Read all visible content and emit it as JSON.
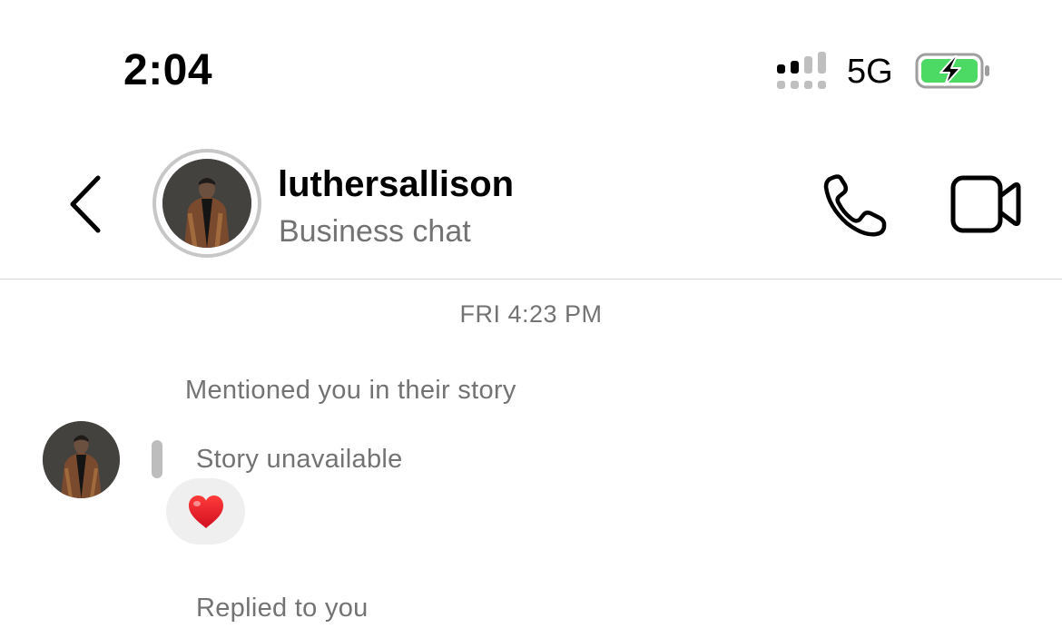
{
  "status_bar": {
    "time": "2:04",
    "network": "5G",
    "icons": [
      "signal-icon",
      "battery-charging-icon"
    ],
    "battery_color": "#4cd964"
  },
  "header": {
    "username": "luthersallison",
    "subtitle": "Business chat",
    "icons": [
      "back-chevron-icon",
      "phone-icon",
      "video-camera-icon"
    ]
  },
  "conversation": {
    "timestamp": "FRI 4:23 PM",
    "mention_label": "Mentioned you in their story",
    "story_status": "Story unavailable",
    "reaction": "❤️",
    "reply_label": "Replied to you"
  },
  "colors": {
    "secondary_text": "#737373",
    "bubble_bg": "#efefef",
    "divider": "#dbdbdb"
  }
}
